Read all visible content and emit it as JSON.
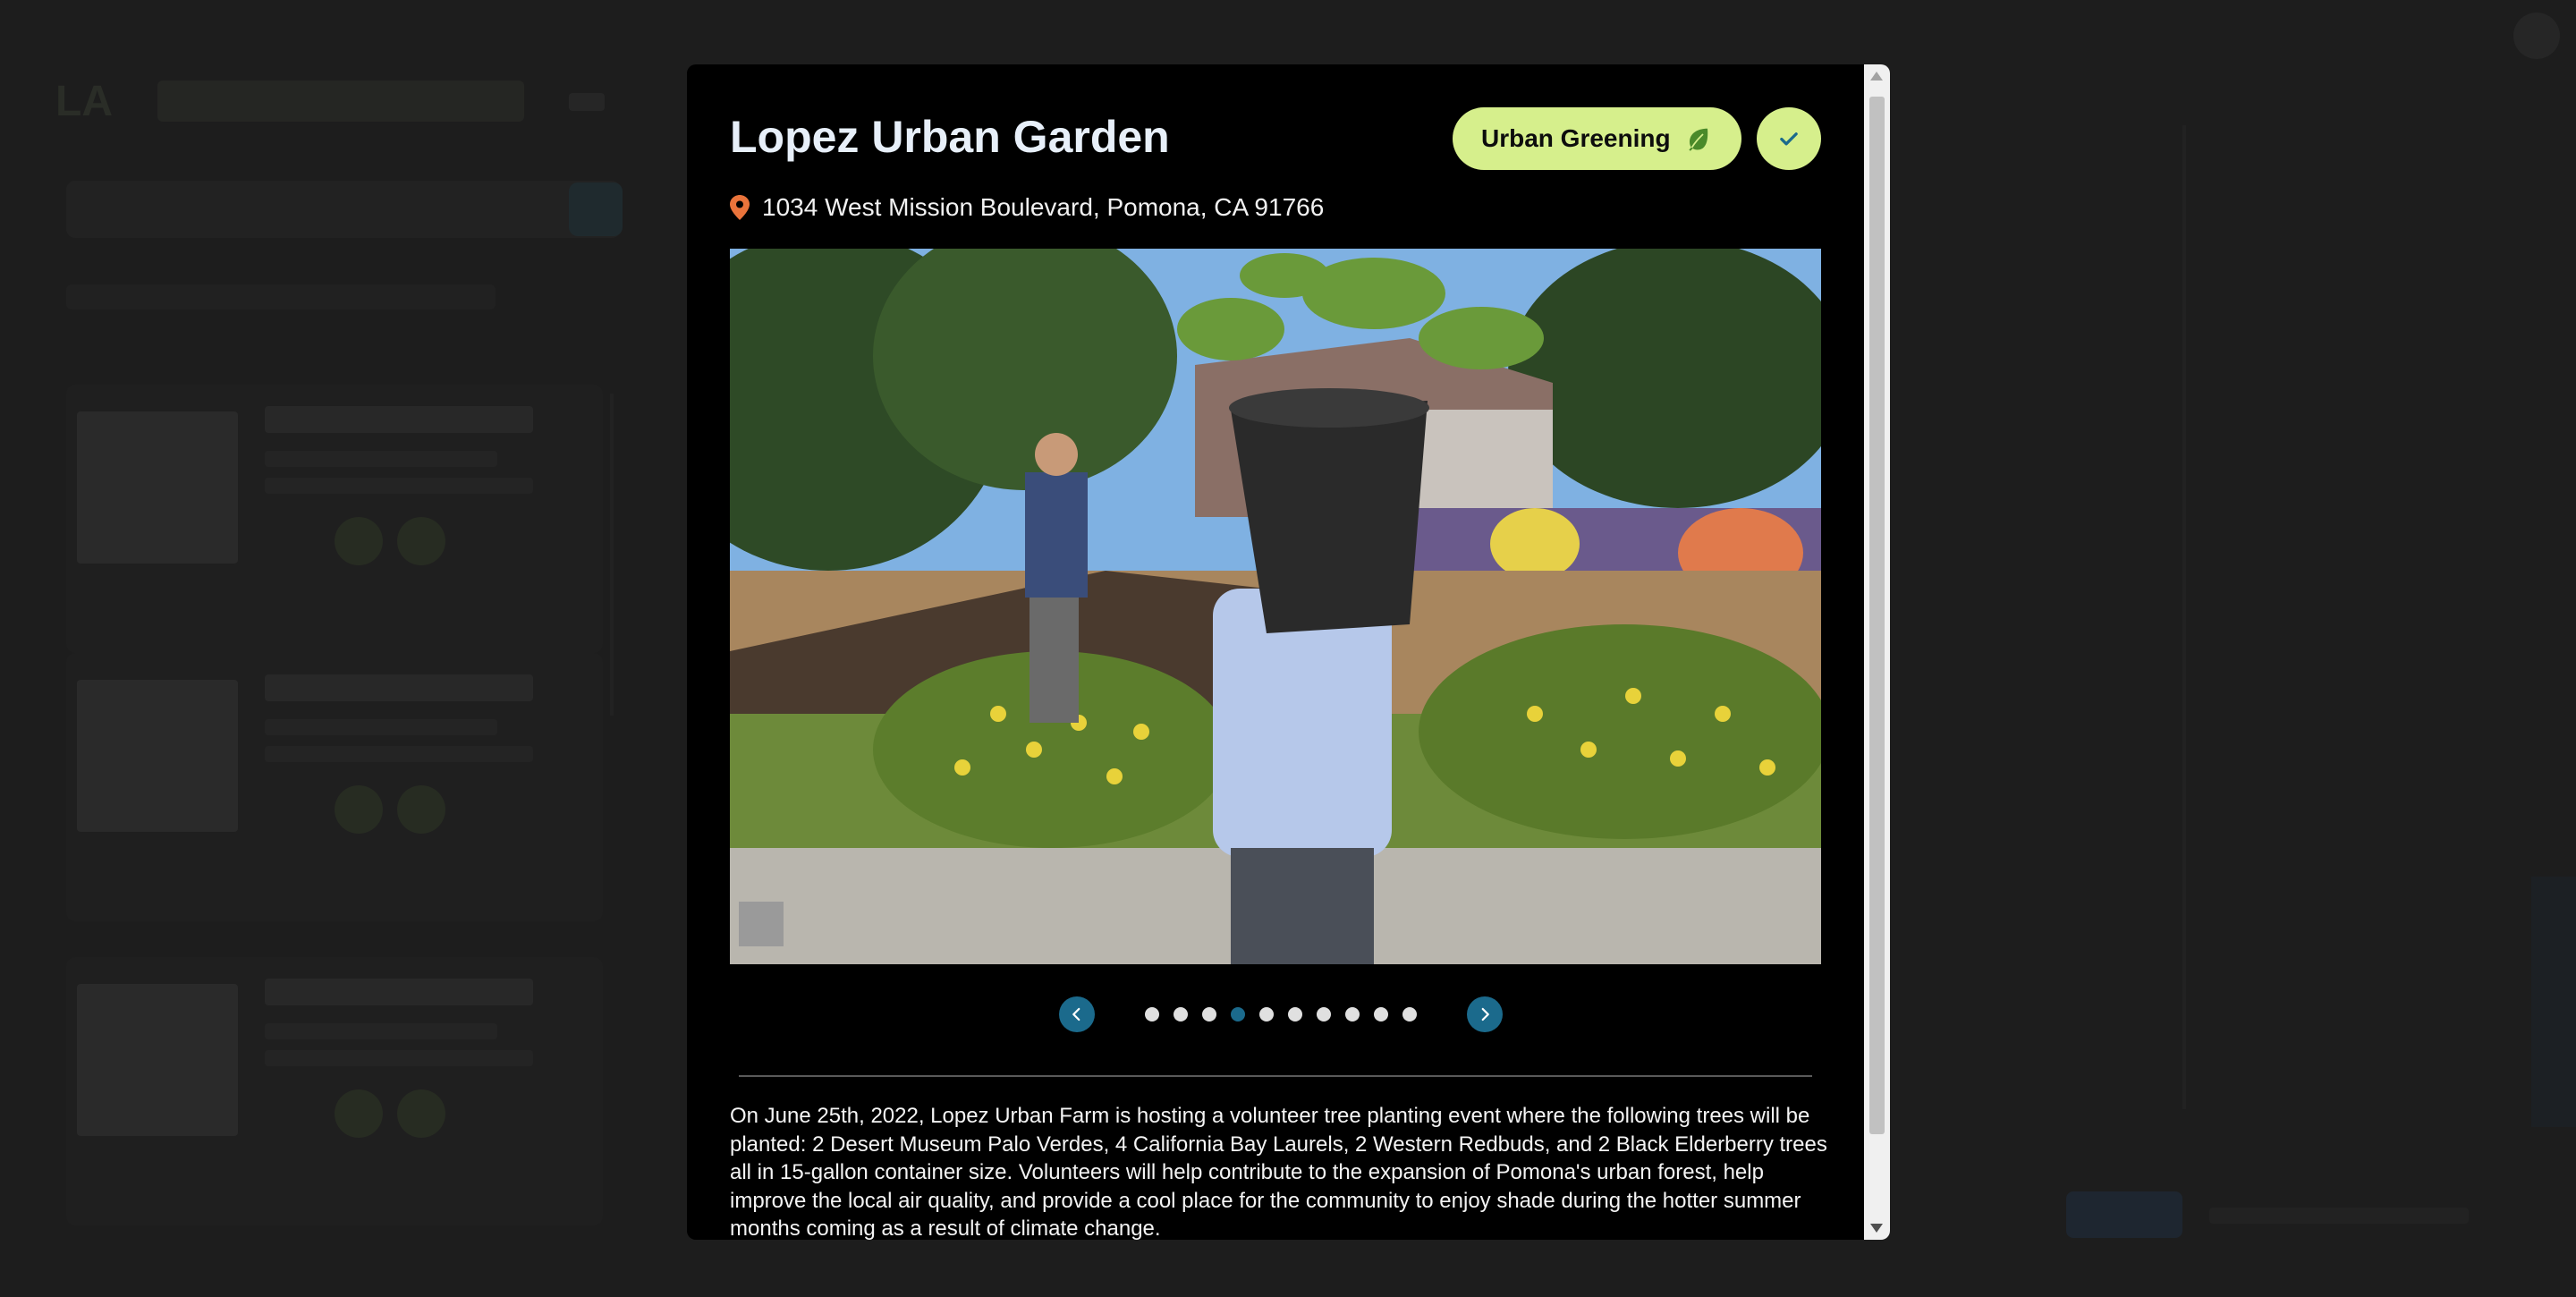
{
  "background": {
    "logo": "LA"
  },
  "modal": {
    "title": "Lopez Urban Garden",
    "category": {
      "label": "Urban Greening",
      "icon": "leaf-icon",
      "color": "#d6ef8c"
    },
    "status_icon": "check-icon",
    "address": "1034 West Mission Boulevard, Pomona, CA 91766",
    "address_icon": "map-pin-icon",
    "photo_alt": "Volunteer carrying a potted tree on his head in an urban garden",
    "carousel": {
      "total": 10,
      "active_index": 3,
      "prev_icon": "chevron-left-icon",
      "next_icon": "chevron-right-icon"
    },
    "description": "On June 25th, 2022, Lopez Urban Farm is hosting a volunteer tree planting event where the following trees will be planted: 2 Desert Museum Palo Verdes, 4 California Bay Laurels, 2 Western Redbuds, and 2 Black Elderberry trees all in 15-gallon container size. Volunteers will help contribute to the expansion of Pomona's urban forest, help improve the local air quality, and provide a cool place for the community to enjoy shade during the hotter summer months coming as a result of climate change."
  },
  "colors": {
    "accent": "#1b6a8c",
    "badge": "#d6ef8c",
    "pin": "#e9733b"
  }
}
